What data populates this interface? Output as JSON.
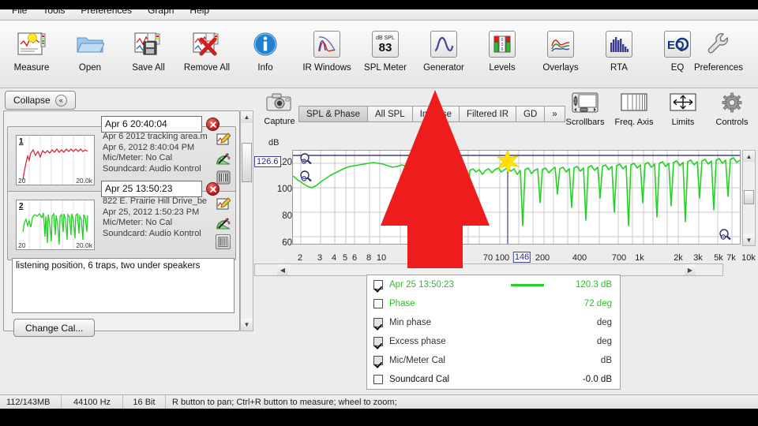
{
  "app": {
    "menu": [
      "File",
      "Tools",
      "Preferences",
      "Graph",
      "Help"
    ]
  },
  "toolbar": {
    "left_buttons": [
      {
        "label": "Measure",
        "icon": "measure-icon"
      },
      {
        "label": "Open",
        "icon": "folder-open-icon"
      },
      {
        "label": "Save All",
        "icon": "save-icon"
      },
      {
        "label": "Remove All",
        "icon": "remove-icon"
      },
      {
        "label": "Info",
        "icon": "info-icon"
      }
    ],
    "center_buttons": [
      {
        "label": "IR Windows",
        "icon": "ir-windows-icon"
      },
      {
        "label": "SPL Meter",
        "icon": "spl-meter-icon",
        "icon_top": "dB SPL",
        "icon_value": "83"
      },
      {
        "label": "Generator",
        "icon": "generator-icon"
      },
      {
        "label": "Levels",
        "icon": "levels-icon"
      },
      {
        "label": "Overlays",
        "icon": "overlays-icon"
      },
      {
        "label": "RTA",
        "icon": "rta-icon"
      },
      {
        "label": "EQ",
        "icon": "eq-icon",
        "icon_text": "EQ"
      }
    ],
    "right_buttons": [
      {
        "label": "Preferences",
        "icon": "wrench-icon"
      }
    ]
  },
  "left_panel": {
    "collapse_label": "Collapse",
    "collapse_icon": "double-chevron-left-icon",
    "measurements": [
      {
        "index": "1",
        "title": "Apr 6 20:40:04",
        "name": "Apr 6 2012 tracking area.m",
        "datetime": "Apr 6, 2012 8:40:04 PM",
        "mic": "Mic/Meter: No Cal",
        "soundcard": "Soundcard: Audio Kontrol",
        "thumb_low": "20",
        "thumb_high": "20.0k",
        "trace_color": "#d42a3c"
      },
      {
        "index": "2",
        "title": "Apr 25 13:50:23",
        "name": "822 E. Prairie Hill Drive_be",
        "datetime": "Apr 25, 2012 1:50:23 PM",
        "mic": "Mic/Meter: No Cal",
        "soundcard": "Soundcard: Audio Kontrol",
        "thumb_low": "20",
        "thumb_high": "20.0k",
        "trace_color": "#22d223"
      }
    ],
    "notes": "listening position, 6 traps, two under speakers",
    "change_cal_label": "Change Cal..."
  },
  "graph_toolbar": {
    "capture_label": "Capture",
    "capture_icon": "camera-icon",
    "tabs": [
      {
        "label": "SPL & Phase",
        "selected": true
      },
      {
        "label": "All SPL",
        "selected": false
      },
      {
        "label": "Impulse",
        "selected": false
      },
      {
        "label": "Filtered IR",
        "selected": false
      },
      {
        "label": "GD",
        "selected": false
      },
      {
        "label": "»",
        "selected": false
      }
    ],
    "tools": [
      {
        "label": "Scrollbars",
        "icon": "scrollbars-icon"
      },
      {
        "label": "Freq. Axis",
        "icon": "freq-axis-icon"
      },
      {
        "label": "Limits",
        "icon": "limits-arrows-icon"
      },
      {
        "label": "Controls",
        "icon": "gear-icon"
      }
    ]
  },
  "chart_data": {
    "type": "line",
    "title": "",
    "xlabel": "",
    "ylabel": "dB",
    "xscale": "log",
    "xlim": [
      2,
      14000
    ],
    "ylim": [
      52,
      130
    ],
    "grid": true,
    "y_ticks": [
      120,
      100,
      80,
      60
    ],
    "x_ticks": [
      "2",
      "3",
      "4",
      "5",
      "6",
      "8",
      "10",
      "20",
      "70",
      "100",
      "200",
      "400",
      "700",
      "1k",
      "2k",
      "3k",
      "5k",
      "7k",
      "10k"
    ],
    "y_value_box": "126.6",
    "x_value_box": "146",
    "cursor_freq_hz": 146,
    "marker": {
      "icon": "star-marker",
      "freq_hz": 146,
      "spl_db": 120.3,
      "color": "#ffe400"
    },
    "series": [
      {
        "name": "Apr 25 13:50:23",
        "color": "#22d223",
        "readout_db": "120.3 dB",
        "points_note": "SPL response trace, rising from ~100 dB at 20 Hz to ~120 dB plateau above 150 Hz with dense comb-filter nulls toward 10 kHz"
      }
    ],
    "limit_line_db": 126.6
  },
  "legend": {
    "rows": [
      {
        "label": "Apr 25 13:50:23",
        "checked": true,
        "enabled": true,
        "value": "120.3 dB",
        "green": true,
        "swatch": true
      },
      {
        "label": "Phase",
        "checked": false,
        "enabled": true,
        "value": "72 deg",
        "green": true,
        "swatch": false
      },
      {
        "label": "Min phase",
        "checked": true,
        "enabled": false,
        "value": "deg",
        "green": false,
        "swatch": false
      },
      {
        "label": "Excess phase",
        "checked": true,
        "enabled": false,
        "value": "deg",
        "green": false,
        "swatch": false
      },
      {
        "label": "Mic/Meter Cal",
        "checked": true,
        "enabled": false,
        "value": "dB",
        "green": false,
        "swatch": false
      },
      {
        "label": "Soundcard Cal",
        "checked": false,
        "enabled": true,
        "value": "-0.0 dB",
        "green": false,
        "swatch": false
      }
    ]
  },
  "status_bar": {
    "memory": "112/143MB",
    "sample_rate": "44100 Hz",
    "bit_depth": "16 Bit",
    "hint": "R button to pan; Ctrl+R button to measure; wheel to zoom;"
  },
  "overlay": {
    "arrow_color": "#ee1c1c",
    "arrow_name": "red-pointer-arrow"
  }
}
